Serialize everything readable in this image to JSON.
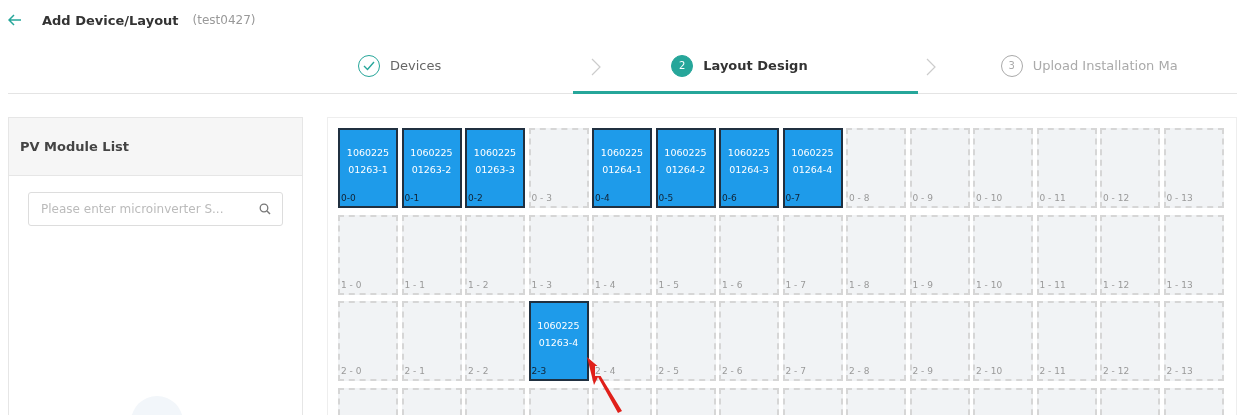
{
  "header": {
    "title": "Add Device/Layout",
    "subtitle": "(test0427)"
  },
  "steps": [
    {
      "label": "Devices",
      "completed": true,
      "selected": false
    },
    {
      "number": "2",
      "label": "Layout Design",
      "completed": false,
      "selected": true
    },
    {
      "number": "3",
      "label": "Upload Installation Ma",
      "completed": false,
      "selected": false
    }
  ],
  "module_list": {
    "title": "PV Module List",
    "search": {
      "placeholder": "Please enter microinverter S..."
    }
  },
  "grid": {
    "rows": [
      {
        "cells": [
          {
            "kind": "module",
            "lines": [
              "1060225",
              "01263-1"
            ],
            "label": "0-0"
          },
          {
            "kind": "module",
            "lines": [
              "1060225",
              "01263-2"
            ],
            "label": "0-1"
          },
          {
            "kind": "module",
            "lines": [
              "1060225",
              "01263-3"
            ],
            "label": "0-2"
          },
          {
            "kind": "empty",
            "label": "0 - 3"
          },
          {
            "kind": "module",
            "lines": [
              "1060225",
              "01264-1"
            ],
            "label": "0-4"
          },
          {
            "kind": "module",
            "lines": [
              "1060225",
              "01264-2"
            ],
            "label": "0-5"
          },
          {
            "kind": "module",
            "lines": [
              "1060225",
              "01264-3"
            ],
            "label": "0-6"
          },
          {
            "kind": "module",
            "lines": [
              "1060225",
              "01264-4"
            ],
            "label": "0-7"
          },
          {
            "kind": "empty",
            "label": "0 - 8"
          },
          {
            "kind": "empty",
            "label": "0 - 9"
          },
          {
            "kind": "empty",
            "label": "0 - 10"
          },
          {
            "kind": "empty",
            "label": "0 - 11"
          },
          {
            "kind": "empty",
            "label": "0 - 12"
          },
          {
            "kind": "empty",
            "label": "0 - 13"
          }
        ]
      },
      {
        "cells": [
          {
            "kind": "empty",
            "label": "1 - 0"
          },
          {
            "kind": "empty",
            "label": "1 - 1"
          },
          {
            "kind": "empty",
            "label": "1 - 2"
          },
          {
            "kind": "empty",
            "label": "1 - 3"
          },
          {
            "kind": "empty",
            "label": "1 - 4"
          },
          {
            "kind": "empty",
            "label": "1 - 5"
          },
          {
            "kind": "empty",
            "label": "1 - 6"
          },
          {
            "kind": "empty",
            "label": "1 - 7"
          },
          {
            "kind": "empty",
            "label": "1 - 8"
          },
          {
            "kind": "empty",
            "label": "1 - 9"
          },
          {
            "kind": "empty",
            "label": "1 - 10"
          },
          {
            "kind": "empty",
            "label": "1 - 11"
          },
          {
            "kind": "empty",
            "label": "1 - 12"
          },
          {
            "kind": "empty",
            "label": "1 - 13"
          }
        ]
      },
      {
        "cells": [
          {
            "kind": "empty",
            "label": "2 - 0"
          },
          {
            "kind": "empty",
            "label": "2 - 1"
          },
          {
            "kind": "empty",
            "label": "2 - 2"
          },
          {
            "kind": "module",
            "lines": [
              "1060225",
              "01263-4"
            ],
            "label": "2-3"
          },
          {
            "kind": "empty",
            "label": "2 - 4"
          },
          {
            "kind": "empty",
            "label": "2 - 5"
          },
          {
            "kind": "empty",
            "label": "2 - 6"
          },
          {
            "kind": "empty",
            "label": "2 - 7"
          },
          {
            "kind": "empty",
            "label": "2 - 8"
          },
          {
            "kind": "empty",
            "label": "2 - 9"
          },
          {
            "kind": "empty",
            "label": "2 - 10"
          },
          {
            "kind": "empty",
            "label": "2 - 11"
          },
          {
            "kind": "empty",
            "label": "2 - 12"
          },
          {
            "kind": "empty",
            "label": "2 - 13"
          }
        ]
      },
      {
        "cells": [
          {
            "kind": "empty"
          },
          {
            "kind": "empty"
          },
          {
            "kind": "empty"
          },
          {
            "kind": "empty"
          },
          {
            "kind": "empty"
          },
          {
            "kind": "empty"
          },
          {
            "kind": "empty"
          },
          {
            "kind": "empty"
          },
          {
            "kind": "empty"
          },
          {
            "kind": "empty"
          },
          {
            "kind": "empty"
          },
          {
            "kind": "empty"
          },
          {
            "kind": "empty"
          },
          {
            "kind": "empty"
          }
        ]
      }
    ]
  }
}
